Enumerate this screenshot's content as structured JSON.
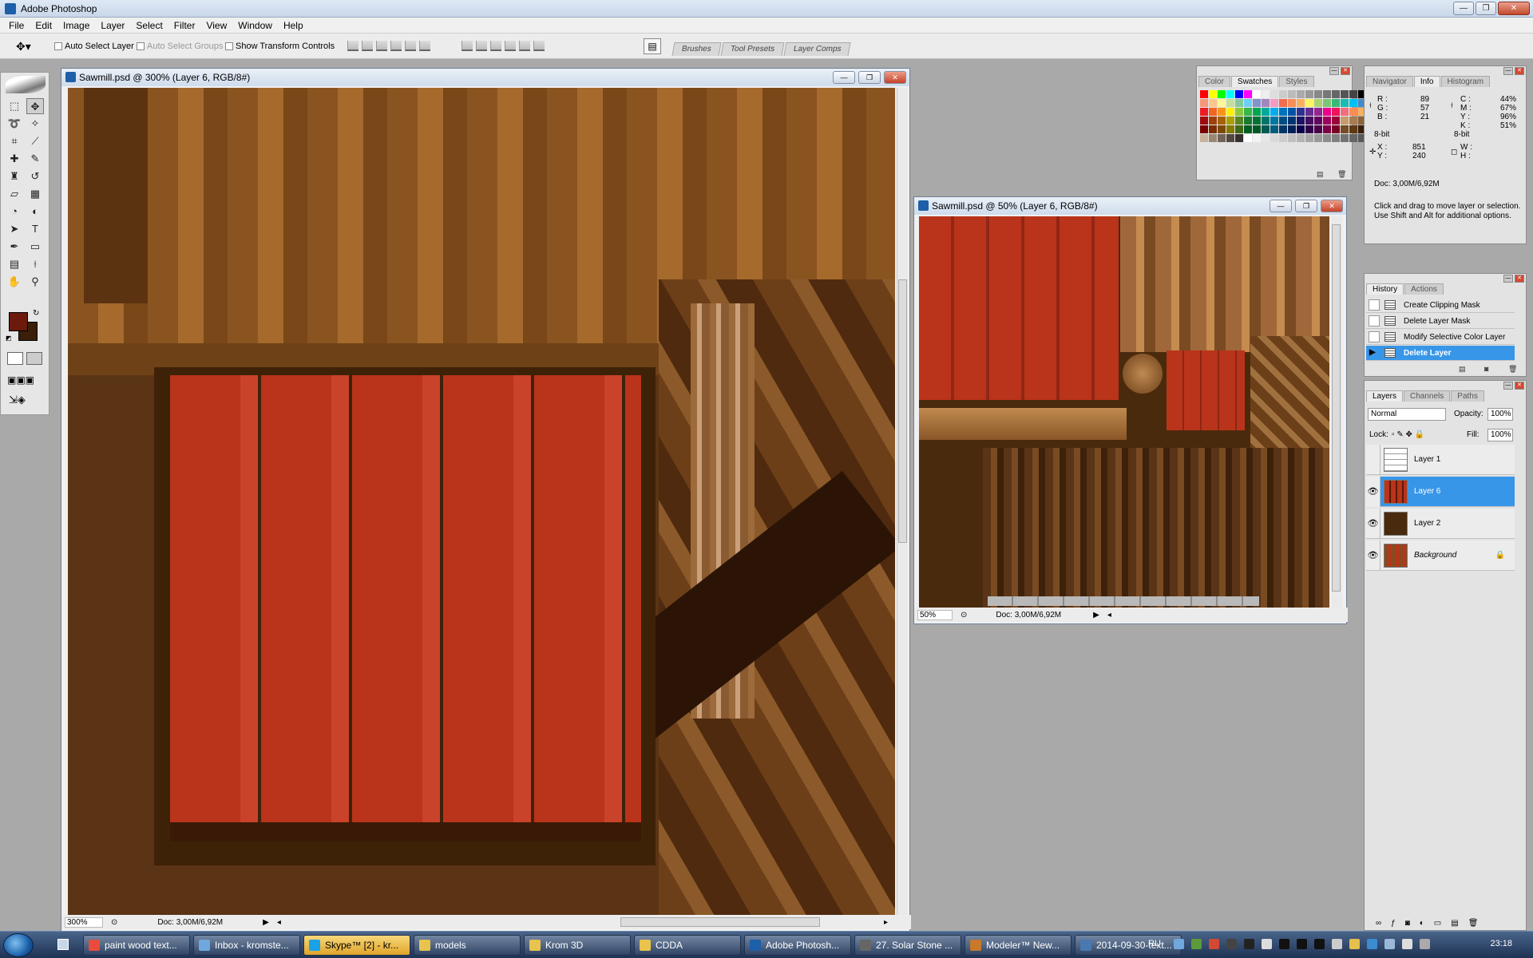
{
  "app": {
    "title": "Adobe Photoshop"
  },
  "menu": [
    "File",
    "Edit",
    "Image",
    "Layer",
    "Select",
    "Filter",
    "View",
    "Window",
    "Help"
  ],
  "options": {
    "auto_select_layer": "Auto Select Layer",
    "auto_select_groups": "Auto Select Groups",
    "show_transform_controls": "Show Transform Controls",
    "panel_tabs": [
      "Brushes",
      "Tool Presets",
      "Layer Comps"
    ]
  },
  "doc1": {
    "title": "Sawmill.psd @ 300% (Layer 6, RGB/8#)",
    "zoom": "300%",
    "doc_size": "Doc: 3,00M/6,92M"
  },
  "doc2": {
    "title": "Sawmill.psd @ 50% (Layer 6, RGB/8#)",
    "zoom": "50%",
    "doc_size": "Doc: 3,00M/6,92M"
  },
  "color_panel": {
    "tabs": [
      "Color",
      "Swatches",
      "Styles"
    ],
    "active": "Swatches"
  },
  "info_panel": {
    "tabs": [
      "Navigator",
      "Info",
      "Histogram"
    ],
    "r": "89",
    "g": "57",
    "b": "21",
    "c": "44%",
    "m": "67%",
    "y": "96%",
    "k": "51%",
    "bit_left": "8-bit",
    "bit_right": "8-bit",
    "x": "851",
    "y_coord": "240",
    "doc": "Doc: 3,00M/6,92M",
    "hint": "Click and drag to move layer or selection.  Use Shift and Alt for additional options.",
    "labels": {
      "r": "R :",
      "g": "G :",
      "b": "B :",
      "c": "C :",
      "m": "M :",
      "y": "Y :",
      "k": "K :",
      "x": "X :",
      "yl": "Y :",
      "w": "W :",
      "h": "H :"
    }
  },
  "history_panel": {
    "tabs": [
      "History",
      "Actions"
    ],
    "items": [
      "Create Clipping Mask",
      "Delete Layer Mask",
      "Modify Selective Color Layer",
      "Delete Layer"
    ]
  },
  "layers_panel": {
    "tabs": [
      "Layers",
      "Channels",
      "Paths"
    ],
    "blend_mode": "Normal",
    "opacity_label": "Opacity:",
    "opacity": "100%",
    "lock_label": "Lock:",
    "fill_label": "Fill:",
    "fill": "100%",
    "layers": [
      "Layer 1",
      "Layer 6",
      "Layer 2",
      "Background"
    ]
  },
  "taskbar": {
    "items": [
      "paint wood text...",
      "Inbox - kromste...",
      "Skype™ [2] - kr...",
      "models",
      "Krom 3D",
      "CDDA",
      "Adobe Photosh...",
      "27. Solar Stone ...",
      "Modeler™ New...",
      "2014-09-30-text..."
    ],
    "lang": "RU",
    "clock": "23:18"
  },
  "colors": {
    "foreground": "#6b1a0c",
    "background": "#3a1e0a",
    "selection": "#3896e8",
    "accent": "#1d5fa8"
  }
}
